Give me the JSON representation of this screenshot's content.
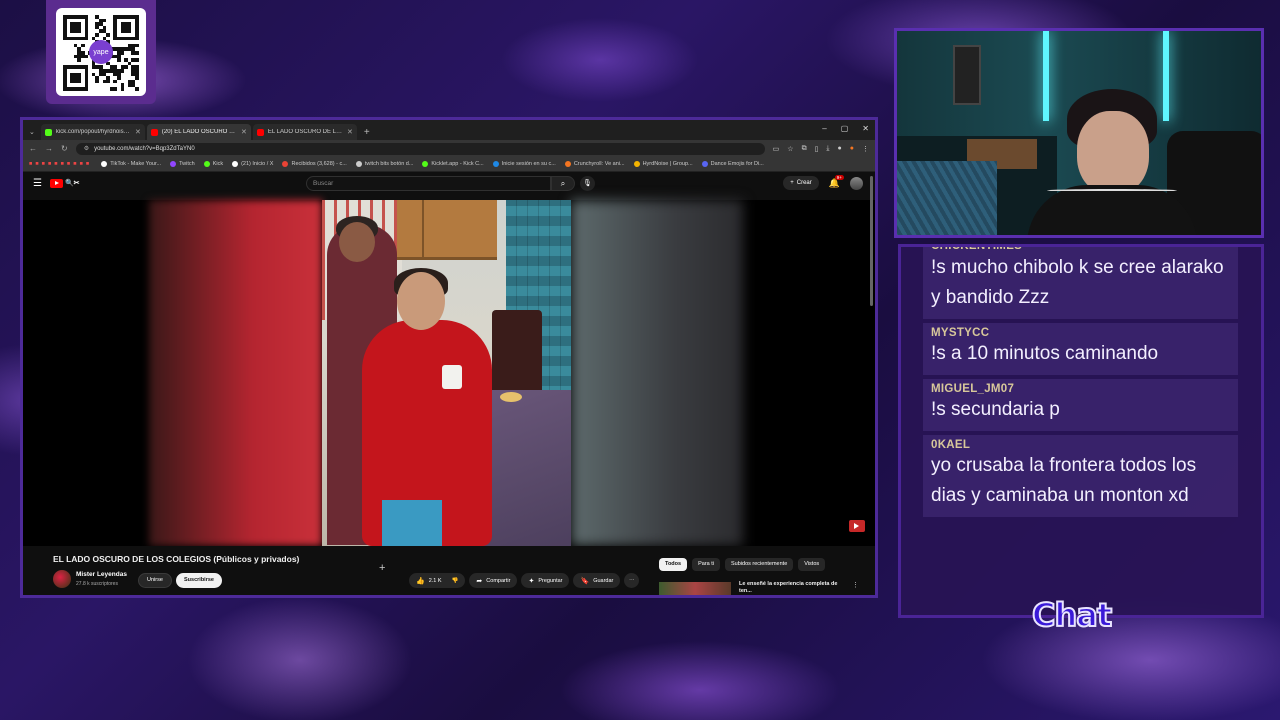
{
  "qr": {
    "logo_text": "yape"
  },
  "browser": {
    "tabs": [
      {
        "title": "kick.com/popout/hyrdnoise/ch",
        "color": "#53fc18",
        "active": false
      },
      {
        "title": "(20) EL LADO OSCURO DE LOS CO",
        "color": "#ff0000",
        "active": true
      },
      {
        "title": "EL LADO OSCURO DE LOS CO",
        "color": "#ff0000",
        "active": false
      }
    ],
    "new_tab": "+",
    "window_controls": [
      "–",
      "▢",
      "✕"
    ],
    "url": "youtube.com/watch?v=Bqp3ZdTaYN0",
    "bookmarks": [
      {
        "label": "TikTok - Make Your...",
        "color": "#ffffff"
      },
      {
        "label": "Twitch",
        "color": "#9146ff"
      },
      {
        "label": "Kick",
        "color": "#53fc18"
      },
      {
        "label": "(21) Inicio / X",
        "color": "#ffffff"
      },
      {
        "label": "Recibidos (3,628) - c...",
        "color": "#ea4335"
      },
      {
        "label": "twitch bits botón d...",
        "color": "#cccccc"
      },
      {
        "label": "Kicklet.app - Kick C...",
        "color": "#53fc18"
      },
      {
        "label": "Inicie sesión en su c...",
        "color": "#1e88e5"
      },
      {
        "label": "Crunchyroll: Ve ani...",
        "color": "#f47521"
      },
      {
        "label": "HyrdNoise | Group...",
        "color": "#f4b400"
      },
      {
        "label": "Dance Emojis for Di...",
        "color": "#5865f2"
      }
    ]
  },
  "youtube": {
    "logo_suffix": "🔍✂",
    "search_placeholder": "Buscar",
    "create_label": "Crear",
    "notif_count": "9+",
    "video_title": "EL LADO OSCURO DE LOS COLEGIOS (Públicos y privados)",
    "channel_name": "Mister Leyendas",
    "channel_subs": "27.8 k suscriptores",
    "join_label": "Unirse",
    "subscribe_label": "Suscribirse",
    "likes": "2.1 K",
    "share_label": "Compartir",
    "ask_label": "Preguntar",
    "save_label": "Guardar",
    "chips": [
      "Todos",
      "Para ti",
      "Subidos recientemente",
      "Vistos"
    ],
    "rec_title": "Le enseñé la experiencia completa de ten..."
  },
  "chat": {
    "partial_user": "CHICKENTIMES",
    "messages": [
      {
        "user": "",
        "text": "!s mucho chibolo k se cree alarako y bandido Zzz"
      },
      {
        "user": "MYSTYCC",
        "text": "!s a 10 minutos caminando"
      },
      {
        "user": "MIGUEL_JM07",
        "text": "!s secundaria p"
      },
      {
        "user": "0KAEL",
        "text": "yo crusaba la frontera todos los dias y caminaba un monton xd"
      }
    ],
    "label": "Chat"
  },
  "colors": {
    "accent": "#5a2fb0",
    "chat_user": "#d8c89a",
    "yt_red": "#ff0000"
  }
}
